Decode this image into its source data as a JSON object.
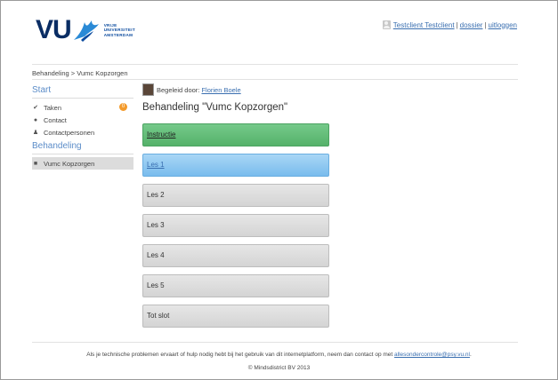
{
  "brand": {
    "logo_text": "VU",
    "university_lines": [
      "VRIJE",
      "UNIVERSITEIT",
      "AMSTERDAM"
    ]
  },
  "user_nav": {
    "user_name": "Testclient Testclient",
    "separator": "|",
    "dossier": "dossier",
    "logout": "uitloggen"
  },
  "breadcrumb": "Behandeling > Vumc Kopzorgen",
  "sidebar": {
    "start_heading": "Start",
    "items": [
      {
        "icon": "check-icon",
        "label": "Taken",
        "badge": "0"
      },
      {
        "icon": "chat-icon",
        "label": "Contact"
      },
      {
        "icon": "person-icon",
        "label": "Contactpersonen"
      }
    ],
    "treatment_heading": "Behandeling",
    "treatment_items": [
      {
        "icon": "folder-icon",
        "label": "Vumc Kopzorgen"
      }
    ]
  },
  "guide": {
    "label": "Begeleid door:",
    "name": "Florien Boele"
  },
  "page_title": "Behandeling \"Vumc Kopzorgen\"",
  "lessons": [
    {
      "label": "Instructie",
      "state": "completed"
    },
    {
      "label": "Les 1",
      "state": "current"
    },
    {
      "label": "Les 2",
      "state": "locked"
    },
    {
      "label": "Les 3",
      "state": "locked"
    },
    {
      "label": "Les 4",
      "state": "locked"
    },
    {
      "label": "Les 5",
      "state": "locked"
    },
    {
      "label": "Tot slot",
      "state": "locked"
    }
  ],
  "footer": {
    "help_text": "Als je technische problemen ervaart of hulp nodig hebt bij het gebruik van dit internetplatform, neem dan contact op met",
    "email": "allesondercontrole@psy.vu.nl",
    "period": ".",
    "copyright": "© Mindsdistrict BV 2013"
  },
  "colors": {
    "lesson_completed": "#5fba73",
    "lesson_current": "#8ec9f1",
    "lesson_locked": "#dcdcdc",
    "badge": "#f39a2b",
    "link": "#3a6fb0",
    "brand_navy": "#0a2d64"
  }
}
